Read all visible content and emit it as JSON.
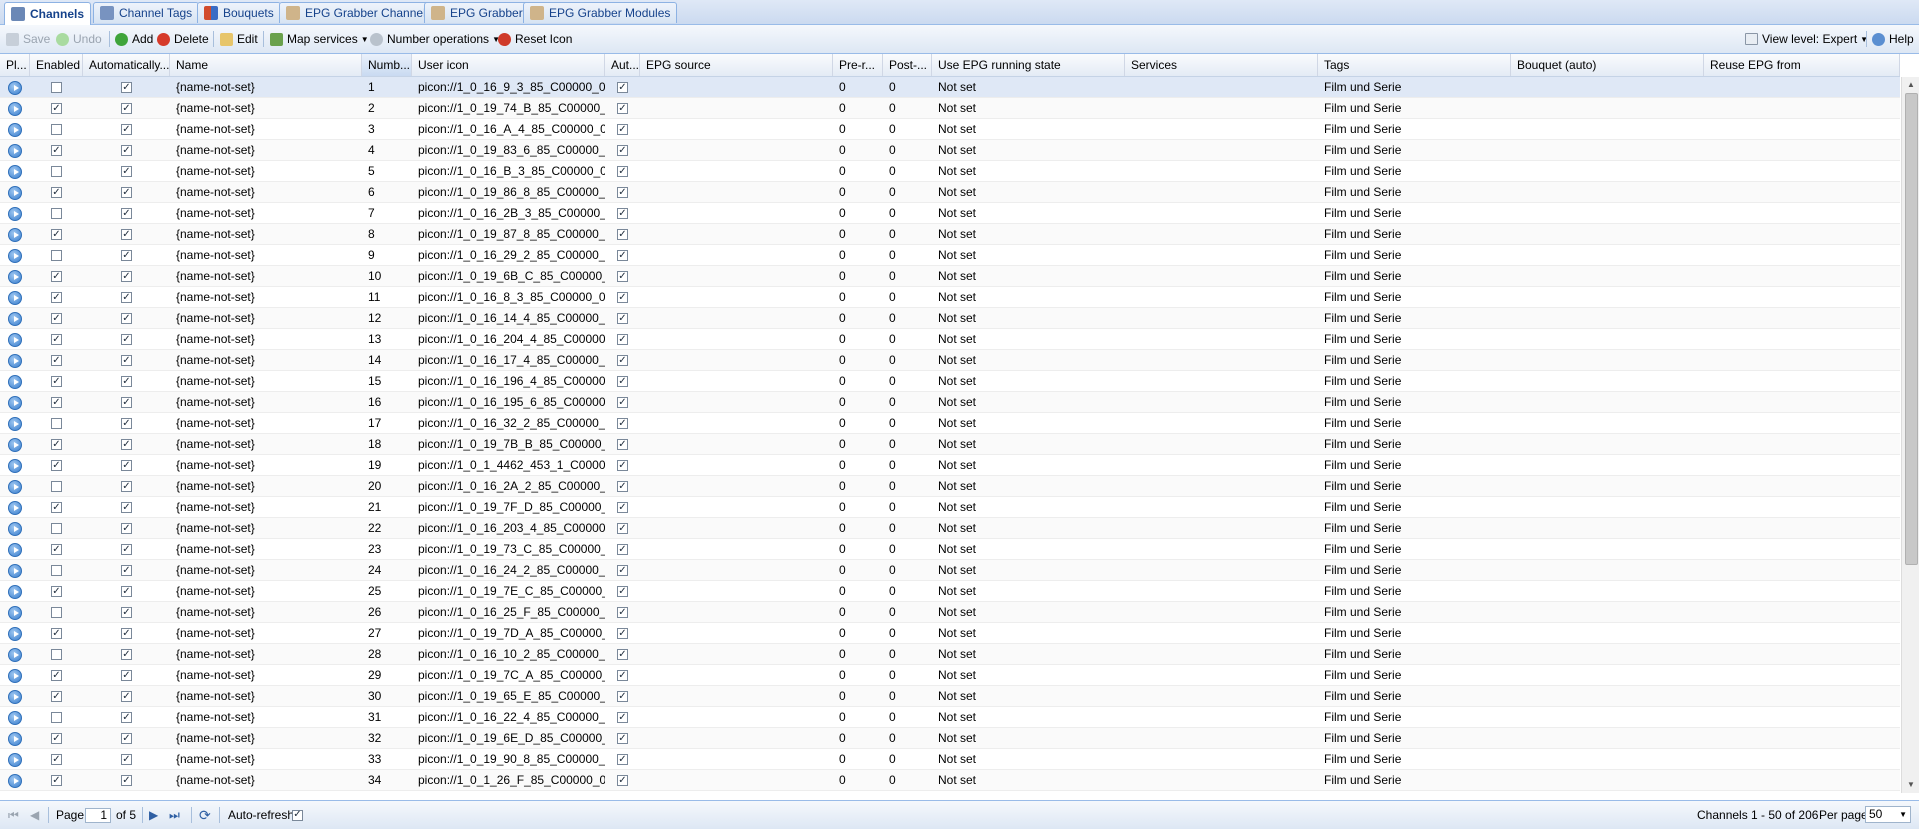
{
  "tabs": [
    {
      "label": "Channels",
      "icon": "channels-icon",
      "color": "#6b88b6"
    },
    {
      "label": "Channel Tags",
      "icon": "channel-tags-icon",
      "color": "#7893c0"
    },
    {
      "label": "Bouquets",
      "icon": "bouquets-icon",
      "color": "#d24b2c"
    },
    {
      "label": "EPG Grabber Channels",
      "icon": "epg-grabber-channels-icon",
      "color": "#b48c5a"
    },
    {
      "label": "EPG Grabber",
      "icon": "epg-grabber-icon",
      "color": "#b48c5a"
    },
    {
      "label": "EPG Grabber Modules",
      "icon": "epg-grabber-modules-icon",
      "color": "#b48c5a"
    }
  ],
  "toolbar": {
    "save": "Save",
    "undo": "Undo",
    "add": "Add",
    "delete": "Delete",
    "edit": "Edit",
    "map_services": "Map services",
    "number_operations": "Number operations",
    "reset_icon": "Reset Icon",
    "view_level": "View level: Expert",
    "help": "Help"
  },
  "columns": [
    "Pl...",
    "Enabled",
    "Automatically...",
    "Name",
    "Numb...",
    "User icon",
    "Aut...",
    "EPG source",
    "Pre-r...",
    "Post-...",
    "Use EPG running state",
    "Services",
    "Tags",
    "Bouquet (auto)",
    "Reuse EPG from"
  ],
  "rows": [
    {
      "en": false,
      "name": "{name-not-set}",
      "num": "1",
      "icon": "picon://1_0_16_9_3_85_C00000_0...",
      "pre": "0",
      "post": "0",
      "epg": "Not set",
      "tags": "Film und Serie"
    },
    {
      "en": true,
      "name": "{name-not-set}",
      "num": "2",
      "icon": "picon://1_0_19_74_B_85_C00000_...",
      "pre": "0",
      "post": "0",
      "epg": "Not set",
      "tags": "Film und Serie"
    },
    {
      "en": false,
      "name": "{name-not-set}",
      "num": "3",
      "icon": "picon://1_0_16_A_4_85_C00000_0...",
      "pre": "0",
      "post": "0",
      "epg": "Not set",
      "tags": "Film und Serie"
    },
    {
      "en": true,
      "name": "{name-not-set}",
      "num": "4",
      "icon": "picon://1_0_19_83_6_85_C00000_...",
      "pre": "0",
      "post": "0",
      "epg": "Not set",
      "tags": "Film und Serie"
    },
    {
      "en": false,
      "name": "{name-not-set}",
      "num": "5",
      "icon": "picon://1_0_16_B_3_85_C00000_0...",
      "pre": "0",
      "post": "0",
      "epg": "Not set",
      "tags": "Film und Serie"
    },
    {
      "en": true,
      "name": "{name-not-set}",
      "num": "6",
      "icon": "picon://1_0_19_86_8_85_C00000_...",
      "pre": "0",
      "post": "0",
      "epg": "Not set",
      "tags": "Film und Serie"
    },
    {
      "en": false,
      "name": "{name-not-set}",
      "num": "7",
      "icon": "picon://1_0_16_2B_3_85_C00000_...",
      "pre": "0",
      "post": "0",
      "epg": "Not set",
      "tags": "Film und Serie"
    },
    {
      "en": true,
      "name": "{name-not-set}",
      "num": "8",
      "icon": "picon://1_0_19_87_8_85_C00000_...",
      "pre": "0",
      "post": "0",
      "epg": "Not set",
      "tags": "Film und Serie"
    },
    {
      "en": false,
      "name": "{name-not-set}",
      "num": "9",
      "icon": "picon://1_0_16_29_2_85_C00000_...",
      "pre": "0",
      "post": "0",
      "epg": "Not set",
      "tags": "Film und Serie"
    },
    {
      "en": true,
      "name": "{name-not-set}",
      "num": "10",
      "icon": "picon://1_0_19_6B_C_85_C00000_...",
      "pre": "0",
      "post": "0",
      "epg": "Not set",
      "tags": "Film und Serie"
    },
    {
      "en": true,
      "name": "{name-not-set}",
      "num": "11",
      "icon": "picon://1_0_16_8_3_85_C00000_0...",
      "pre": "0",
      "post": "0",
      "epg": "Not set",
      "tags": "Film und Serie"
    },
    {
      "en": true,
      "name": "{name-not-set}",
      "num": "12",
      "icon": "picon://1_0_16_14_4_85_C00000_...",
      "pre": "0",
      "post": "0",
      "epg": "Not set",
      "tags": "Film und Serie"
    },
    {
      "en": true,
      "name": "{name-not-set}",
      "num": "13",
      "icon": "picon://1_0_16_204_4_85_C00000...",
      "pre": "0",
      "post": "0",
      "epg": "Not set",
      "tags": "Film und Serie"
    },
    {
      "en": true,
      "name": "{name-not-set}",
      "num": "14",
      "icon": "picon://1_0_16_17_4_85_C00000_...",
      "pre": "0",
      "post": "0",
      "epg": "Not set",
      "tags": "Film und Serie"
    },
    {
      "en": true,
      "name": "{name-not-set}",
      "num": "15",
      "icon": "picon://1_0_16_196_4_85_C00000...",
      "pre": "0",
      "post": "0",
      "epg": "Not set",
      "tags": "Film und Serie"
    },
    {
      "en": true,
      "name": "{name-not-set}",
      "num": "16",
      "icon": "picon://1_0_16_195_6_85_C00000...",
      "pre": "0",
      "post": "0",
      "epg": "Not set",
      "tags": "Film und Serie"
    },
    {
      "en": false,
      "name": "{name-not-set}",
      "num": "17",
      "icon": "picon://1_0_16_32_2_85_C00000_...",
      "pre": "0",
      "post": "0",
      "epg": "Not set",
      "tags": "Film und Serie"
    },
    {
      "en": true,
      "name": "{name-not-set}",
      "num": "18",
      "icon": "picon://1_0_19_7B_B_85_C00000_...",
      "pre": "0",
      "post": "0",
      "epg": "Not set",
      "tags": "Film und Serie"
    },
    {
      "en": true,
      "name": "{name-not-set}",
      "num": "19",
      "icon": "picon://1_0_1_4462_453_1_C0000...",
      "pre": "0",
      "post": "0",
      "epg": "Not set",
      "tags": "Film und Serie"
    },
    {
      "en": false,
      "name": "{name-not-set}",
      "num": "20",
      "icon": "picon://1_0_16_2A_2_85_C00000_...",
      "pre": "0",
      "post": "0",
      "epg": "Not set",
      "tags": "Film und Serie"
    },
    {
      "en": true,
      "name": "{name-not-set}",
      "num": "21",
      "icon": "picon://1_0_19_7F_D_85_C00000_...",
      "pre": "0",
      "post": "0",
      "epg": "Not set",
      "tags": "Film und Serie"
    },
    {
      "en": false,
      "name": "{name-not-set}",
      "num": "22",
      "icon": "picon://1_0_16_203_4_85_C00000...",
      "pre": "0",
      "post": "0",
      "epg": "Not set",
      "tags": "Film und Serie"
    },
    {
      "en": true,
      "name": "{name-not-set}",
      "num": "23",
      "icon": "picon://1_0_19_73_C_85_C00000_...",
      "pre": "0",
      "post": "0",
      "epg": "Not set",
      "tags": "Film und Serie"
    },
    {
      "en": false,
      "name": "{name-not-set}",
      "num": "24",
      "icon": "picon://1_0_16_24_2_85_C00000_...",
      "pre": "0",
      "post": "0",
      "epg": "Not set",
      "tags": "Film und Serie"
    },
    {
      "en": true,
      "name": "{name-not-set}",
      "num": "25",
      "icon": "picon://1_0_19_7E_C_85_C00000_...",
      "pre": "0",
      "post": "0",
      "epg": "Not set",
      "tags": "Film und Serie"
    },
    {
      "en": false,
      "name": "{name-not-set}",
      "num": "26",
      "icon": "picon://1_0_16_25_F_85_C00000_...",
      "pre": "0",
      "post": "0",
      "epg": "Not set",
      "tags": "Film und Serie"
    },
    {
      "en": true,
      "name": "{name-not-set}",
      "num": "27",
      "icon": "picon://1_0_19_7D_A_85_C00000_...",
      "pre": "0",
      "post": "0",
      "epg": "Not set",
      "tags": "Film und Serie"
    },
    {
      "en": false,
      "name": "{name-not-set}",
      "num": "28",
      "icon": "picon://1_0_16_10_2_85_C00000_...",
      "pre": "0",
      "post": "0",
      "epg": "Not set",
      "tags": "Film und Serie"
    },
    {
      "en": true,
      "name": "{name-not-set}",
      "num": "29",
      "icon": "picon://1_0_19_7C_A_85_C00000_...",
      "pre": "0",
      "post": "0",
      "epg": "Not set",
      "tags": "Film und Serie"
    },
    {
      "en": true,
      "name": "{name-not-set}",
      "num": "30",
      "icon": "picon://1_0_19_65_E_85_C00000_...",
      "pre": "0",
      "post": "0",
      "epg": "Not set",
      "tags": "Film und Serie"
    },
    {
      "en": false,
      "name": "{name-not-set}",
      "num": "31",
      "icon": "picon://1_0_16_22_4_85_C00000_...",
      "pre": "0",
      "post": "0",
      "epg": "Not set",
      "tags": "Film und Serie"
    },
    {
      "en": true,
      "name": "{name-not-set}",
      "num": "32",
      "icon": "picon://1_0_19_6E_D_85_C00000_...",
      "pre": "0",
      "post": "0",
      "epg": "Not set",
      "tags": "Film und Serie"
    },
    {
      "en": true,
      "name": "{name-not-set}",
      "num": "33",
      "icon": "picon://1_0_19_90_8_85_C00000_...",
      "pre": "0",
      "post": "0",
      "epg": "Not set",
      "tags": "Film und Serie"
    },
    {
      "en": true,
      "name": "{name-not-set}",
      "num": "34",
      "icon": "picon://1_0_1_26_F_85_C00000_0...",
      "pre": "0",
      "post": "0",
      "epg": "Not set",
      "tags": "Film und Serie"
    }
  ],
  "paging": {
    "page_label": "Page",
    "page_value": "1",
    "of_label": "of 5",
    "auto_refresh": "Auto-refresh",
    "summary": "Channels 1 - 50 of 206",
    "per_page_label": "Per page",
    "per_page_value": "50"
  },
  "colors": {
    "accent": "#15428b",
    "selection": "#dfe8f6",
    "border": "#99bbe8"
  }
}
